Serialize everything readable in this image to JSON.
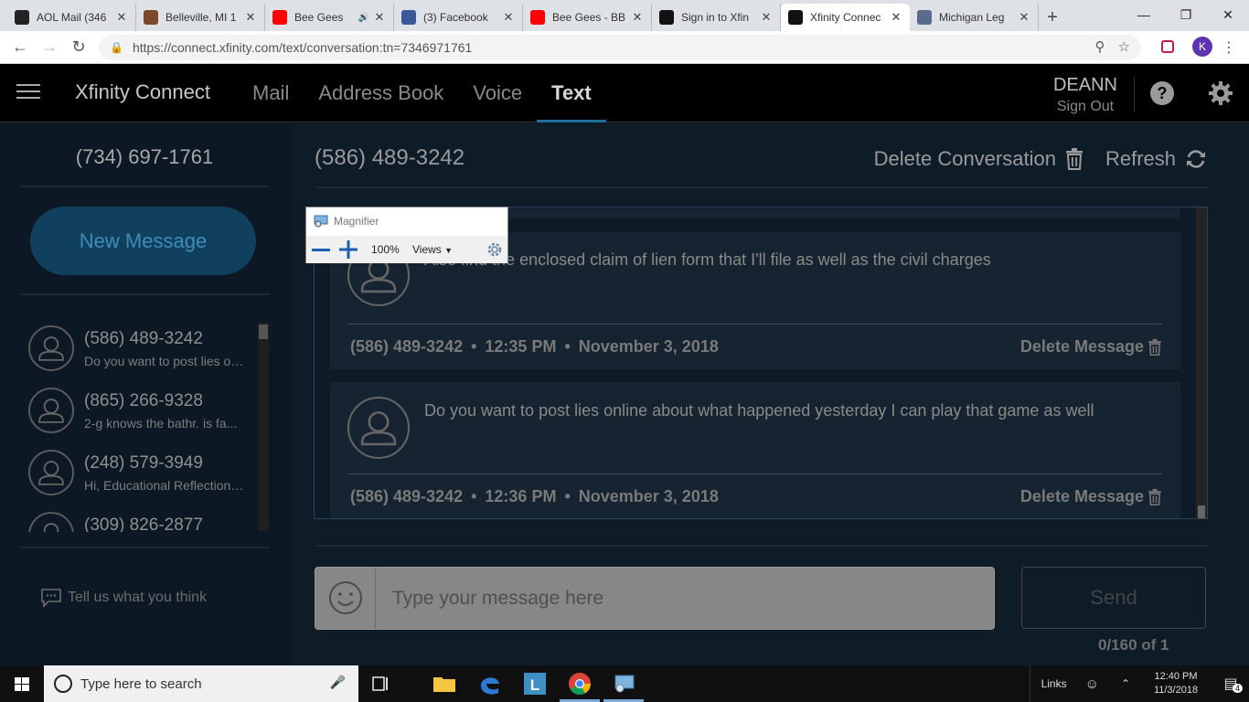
{
  "browser": {
    "tabs": [
      {
        "title": "AOL Mail (346",
        "favicon": "aol-icon",
        "color": "#222222",
        "active": false
      },
      {
        "title": "Belleville, MI 1",
        "favicon": "weather-icon",
        "color": "#7a4a2a",
        "active": false
      },
      {
        "title": "Bee Gees",
        "favicon": "youtube-icon",
        "color": "#ff0000",
        "active": false,
        "audio": true
      },
      {
        "title": "(3) Facebook",
        "favicon": "facebook-icon",
        "color": "#3b5998",
        "active": false
      },
      {
        "title": "Bee Gees - BB",
        "favicon": "youtube-icon",
        "color": "#ff0000",
        "active": false
      },
      {
        "title": "Sign in to Xfin",
        "favicon": "xfinity-icon",
        "color": "#111111",
        "active": false
      },
      {
        "title": "Xfinity Connec",
        "favicon": "xfinity-icon",
        "color": "#111111",
        "active": true
      },
      {
        "title": "Michigan Leg",
        "favicon": "michigan-icon",
        "color": "#5a6b8c",
        "active": false
      }
    ],
    "new_tab_label": "+",
    "url": "https://connect.xfinity.com/text/conversation:tn=7346971761",
    "profile_initial": "K"
  },
  "app": {
    "brand": "Xfinity Connect",
    "nav": [
      {
        "label": "Mail",
        "active": false
      },
      {
        "label": "Address Book",
        "active": false
      },
      {
        "label": "Voice",
        "active": false
      },
      {
        "label": "Text",
        "active": true
      }
    ],
    "user_name": "DEANN",
    "sign_out": "Sign Out",
    "accent": "#1f6f9e"
  },
  "left": {
    "my_number": "(734) 697-1761",
    "new_message": "New Message",
    "conversations": [
      {
        "number": "(586) 489-3242",
        "preview": "Do you want to post lies online about what happened yesterday"
      },
      {
        "number": "(865) 266-9328",
        "preview": "2-g knows the bathr. is fa..."
      },
      {
        "number": "(248) 579-3949",
        "preview": "Hi, Educational Reflections..."
      },
      {
        "number": "(309) 826-2877",
        "preview": ""
      }
    ],
    "feedback": "Tell us what you think"
  },
  "main": {
    "conversation_number": "(586) 489-3242",
    "delete_conversation": "Delete Conversation",
    "refresh": "Refresh",
    "messages": [
      {
        "text": "Also find the enclosed claim of lien form that I'll file as well as the civil charges",
        "sender": "(586) 489-3242",
        "time": "12:35 PM",
        "date": "November 3, 2018",
        "delete_label": "Delete Message"
      },
      {
        "text": "Do you want to post lies online about what happened yesterday I can play that game as well",
        "sender": "(586) 489-3242",
        "time": "12:36 PM",
        "date": "November 3, 2018",
        "delete_label": "Delete Message"
      }
    ],
    "meta_sep": "•",
    "compose_placeholder": "Type your message here",
    "send": "Send",
    "counter": "0/160 of 1"
  },
  "magnifier": {
    "title": "Magnifier",
    "zoom": "100%",
    "views": "Views"
  },
  "taskbar": {
    "search_placeholder": "Type here to search",
    "links": "Links",
    "time": "12:40 PM",
    "date": "11/3/2018",
    "notifications": "4"
  }
}
